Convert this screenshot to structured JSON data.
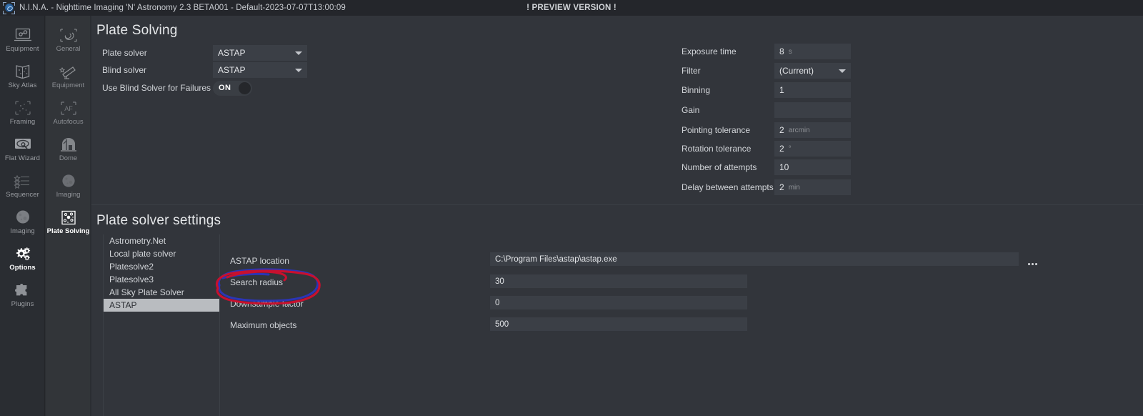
{
  "titlebar": {
    "app_icon": "nina-logo-icon",
    "title": "N.I.N.A. - Nighttime Imaging 'N' Astronomy 2.3 BETA001  -  Default-2023-07-07T13:00:09",
    "preview_banner": "! PREVIEW VERSION !"
  },
  "sidebar_primary": {
    "items": [
      {
        "label": "Equipment",
        "icon": "equipment-icon",
        "active": false
      },
      {
        "label": "Sky Atlas",
        "icon": "sky-atlas-icon",
        "active": false
      },
      {
        "label": "Framing",
        "icon": "framing-icon",
        "active": false
      },
      {
        "label": "Flat Wizard",
        "icon": "flat-wizard-icon",
        "active": false
      },
      {
        "label": "Sequencer",
        "icon": "sequencer-icon",
        "active": false
      },
      {
        "label": "Imaging",
        "icon": "imaging-icon",
        "active": false
      },
      {
        "label": "Options",
        "icon": "gear-icon",
        "active": true
      },
      {
        "label": "Plugins",
        "icon": "puzzle-piece-icon",
        "active": false
      }
    ]
  },
  "sidebar_secondary": {
    "items": [
      {
        "label": "General",
        "icon": "galaxy-icon",
        "active": false
      },
      {
        "label": "Equipment",
        "icon": "telescope-icon",
        "active": false
      },
      {
        "label": "Autofocus",
        "icon": "af-icon",
        "active": false
      },
      {
        "label": "Dome",
        "icon": "dome-icon",
        "active": false
      },
      {
        "label": "Imaging",
        "icon": "moon-icon",
        "active": false
      },
      {
        "label": "Plate Solving",
        "icon": "plate-solving-icon",
        "active": true
      }
    ]
  },
  "plate_solving": {
    "heading": "Plate Solving",
    "left_fields": [
      {
        "label": "Plate solver",
        "value": "ASTAP",
        "type": "dropdown"
      },
      {
        "label": "Blind solver",
        "value": "ASTAP",
        "type": "dropdown"
      }
    ],
    "blind_failure": {
      "label": "Use Blind Solver for Failures",
      "toggle_state": "ON"
    },
    "right_fields": [
      {
        "label": "Exposure time",
        "value": "8",
        "unit": "s",
        "type": "text"
      },
      {
        "label": "Filter",
        "value": "(Current)",
        "unit": "",
        "type": "dropdown"
      },
      {
        "label": "Binning",
        "value": "1",
        "unit": "",
        "type": "text"
      },
      {
        "label": "Gain",
        "value": "",
        "unit": "",
        "type": "text"
      },
      {
        "label": "Pointing tolerance",
        "value": "2",
        "unit": "arcmin",
        "type": "text"
      },
      {
        "label": "Rotation tolerance",
        "value": "2",
        "unit": "°",
        "type": "text"
      },
      {
        "label": "Number of attempts",
        "value": "10",
        "unit": "",
        "type": "text"
      },
      {
        "label": "Delay between attempts",
        "value": "2",
        "unit": "min",
        "type": "text"
      }
    ]
  },
  "solver_settings": {
    "heading": "Plate solver settings",
    "solvers": [
      {
        "label": "Astrometry.Net",
        "selected": false
      },
      {
        "label": "Local plate solver",
        "selected": false
      },
      {
        "label": "Platesolve2",
        "selected": false
      },
      {
        "label": "Platesolve3",
        "selected": false
      },
      {
        "label": "All Sky Plate Solver",
        "selected": false
      },
      {
        "label": "ASTAP",
        "selected": true
      }
    ],
    "fields": [
      {
        "label": "ASTAP location",
        "value": "C:\\Program Files\\astap\\astap.exe",
        "has_browse": true
      },
      {
        "label": "Search radius",
        "value": "30",
        "has_browse": false
      },
      {
        "label": "Downsample factor",
        "value": "0",
        "has_browse": false
      },
      {
        "label": "Maximum objects",
        "value": "500",
        "has_browse": false
      }
    ],
    "browse_button_label": "•••"
  },
  "annotation": {
    "target": "Downsample factor",
    "shape": "hand-drawn-ellipse",
    "colors": {
      "outer": "#c8102e",
      "inner": "#2b35b5"
    }
  },
  "theme": {
    "titlebar_bg": "#24262b",
    "sidebar_primary_bg": "#2a2d32",
    "sidebar_secondary_bg": "#323539",
    "content_bg": "#32353b",
    "control_bg": "#3b3f46",
    "text": "#d8dadd",
    "selected_bg": "#b9bcc0"
  }
}
